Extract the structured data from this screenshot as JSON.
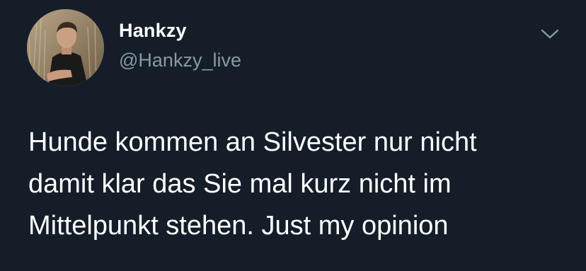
{
  "tweet": {
    "author": {
      "display_name": "Hankzy",
      "handle": "@Hankzy_live",
      "avatar_icon": "profile-photo"
    },
    "menu_icon": "chevron-down-icon",
    "text_lines": [
      "Hunde kommen an Silvester nur nicht",
      "damit klar das Sie mal kurz nicht im",
      "Mittelpunkt stehen. Just my opinion"
    ]
  },
  "colors": {
    "background": "#151d29",
    "text_primary": "#ffffff",
    "text_secondary": "#8899a6"
  }
}
